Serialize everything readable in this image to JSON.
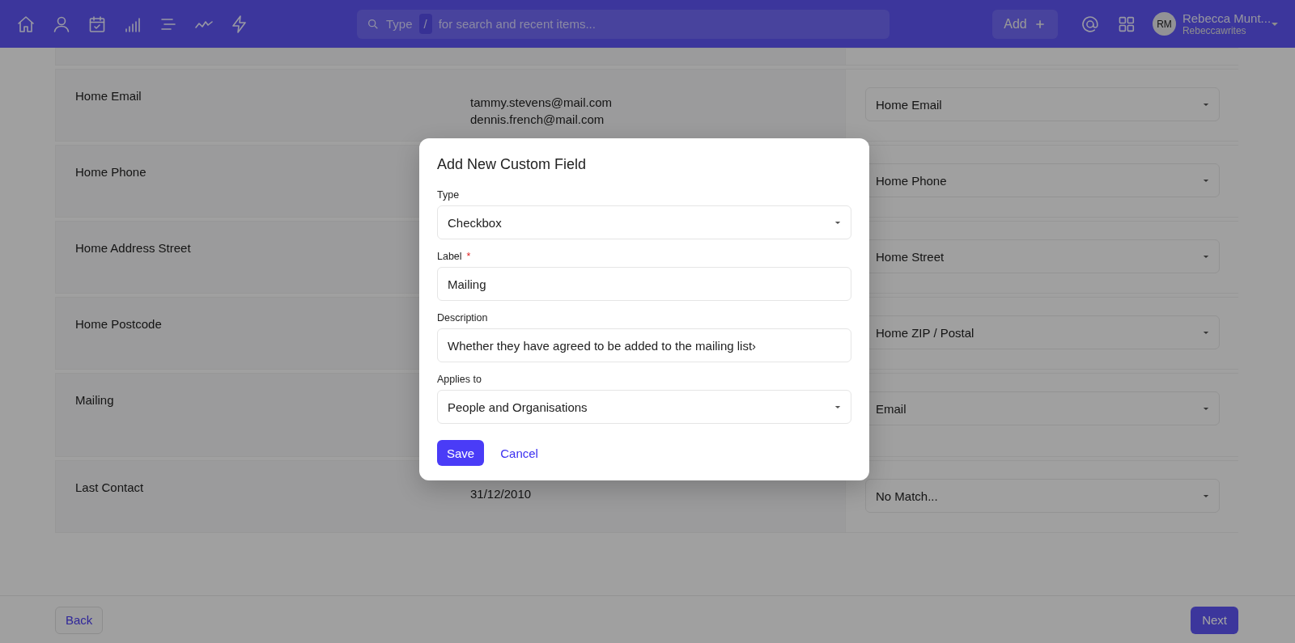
{
  "header": {
    "search": {
      "placeholder_start": "Type",
      "shortcut_key": "/",
      "placeholder_end": "for search and recent items..."
    },
    "add_button": "Add",
    "user": {
      "initials": "RM",
      "name": "Rebecca Munt...",
      "handle": "Rebeccawrites"
    }
  },
  "rows": [
    {
      "label": "Home Email",
      "values": [
        "tammy.stevens@mail.com",
        "dennis.french@mail.com"
      ],
      "mapping": "Home Email"
    },
    {
      "label": "Home Phone",
      "values": [],
      "mapping": "Home Phone"
    },
    {
      "label": "Home Address Street",
      "values": [],
      "mapping": "Home Street"
    },
    {
      "label": "Home Postcode",
      "values": [],
      "mapping": "Home ZIP / Postal"
    },
    {
      "label": "Mailing",
      "values": [],
      "mapping": "Email"
    },
    {
      "label": "Last Contact",
      "values": [
        "31/12/2010"
      ],
      "mapping": "No Match..."
    }
  ],
  "modal": {
    "title": "Add New Custom Field",
    "fields": [
      {
        "kind": "select",
        "label": "Type",
        "value": "Checkbox"
      },
      {
        "kind": "text",
        "label": "Label",
        "required_mark": "*",
        "value": "Mailing"
      },
      {
        "kind": "text",
        "label": "Description",
        "value": "Whether they have agreed to be added to the mailing list›"
      },
      {
        "kind": "select",
        "label": "Applies to",
        "value": "People and Organisations"
      }
    ],
    "buttons": [
      {
        "kind": "primary",
        "label": "Save"
      },
      {
        "kind": "link",
        "label": "Cancel"
      }
    ]
  },
  "footer": {
    "back": "Back",
    "next": "Next"
  }
}
